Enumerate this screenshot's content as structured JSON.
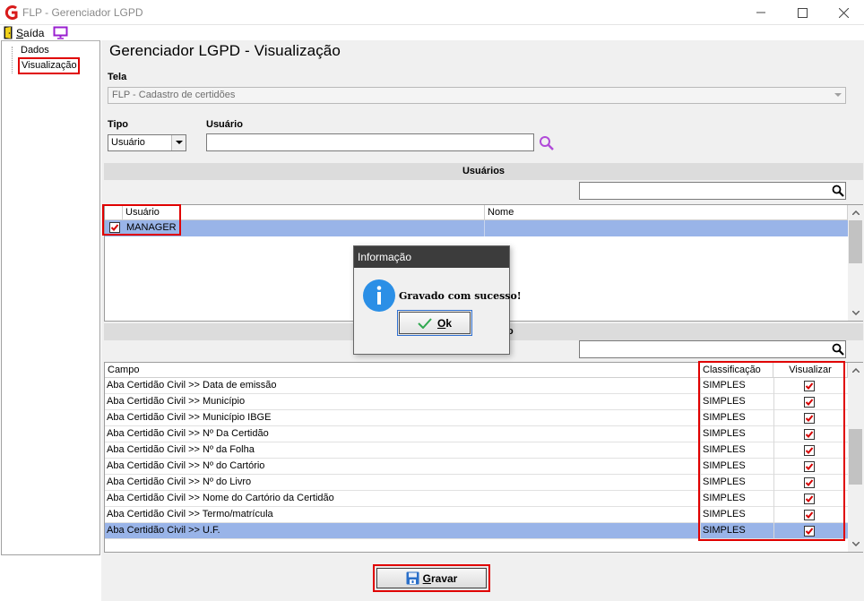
{
  "window": {
    "title": "FLP - Gerenciador LGPD",
    "controls": [
      "minimize-icon",
      "maximize-icon",
      "close-icon"
    ]
  },
  "menu": {
    "saida": "Saída",
    "icons": [
      "exit-door-icon",
      "monitor-icon"
    ]
  },
  "tree": {
    "items": [
      {
        "label": "Dados"
      },
      {
        "label": "Visualização"
      }
    ]
  },
  "main": {
    "title": "Gerenciador LGPD - Visualização",
    "tela": {
      "label": "Tela",
      "value": "FLP - Cadastro de certidões"
    },
    "tipo": {
      "label": "Tipo",
      "value": "Usuário"
    },
    "usuario": {
      "label": "Usuário",
      "value": ""
    }
  },
  "users_section": {
    "header": "Usuários",
    "filter": "",
    "columns": [
      "Usuário",
      "Nome"
    ],
    "rows": [
      {
        "checked": true,
        "usuario": "MANAGER",
        "nome": ""
      }
    ]
  },
  "fields_section": {
    "header_suffix": "o",
    "filter": "",
    "columns": [
      "Campo",
      "Classificação",
      "Visualizar"
    ],
    "rows": [
      {
        "campo": "Aba Certidão Civil >> Data de emissão",
        "classificacao": "SIMPLES",
        "visualizar": true
      },
      {
        "campo": "Aba Certidão Civil >> Município",
        "classificacao": "SIMPLES",
        "visualizar": true
      },
      {
        "campo": "Aba Certidão Civil >> Município IBGE",
        "classificacao": "SIMPLES",
        "visualizar": true
      },
      {
        "campo": "Aba Certidão Civil >> Nº Da Certidão",
        "classificacao": "SIMPLES",
        "visualizar": true
      },
      {
        "campo": "Aba Certidão Civil >> Nº da Folha",
        "classificacao": "SIMPLES",
        "visualizar": true
      },
      {
        "campo": "Aba Certidão Civil >> Nº do Cartório",
        "classificacao": "SIMPLES",
        "visualizar": true
      },
      {
        "campo": "Aba Certidão Civil >> Nº do Livro",
        "classificacao": "SIMPLES",
        "visualizar": true
      },
      {
        "campo": "Aba Certidão Civil >> Nome do Cartório da Certidão",
        "classificacao": "SIMPLES",
        "visualizar": true
      },
      {
        "campo": "Aba Certidão Civil >> Termo/matrícula",
        "classificacao": "SIMPLES",
        "visualizar": true
      },
      {
        "campo": "Aba Certidão Civil >> U.F.",
        "classificacao": "SIMPLES",
        "visualizar": true,
        "selected": true
      }
    ]
  },
  "footer": {
    "gravar_label": "Gravar",
    "gravar_underline": "G",
    "gravar_rest": "ravar"
  },
  "dialog": {
    "title": "Informação",
    "message": "Gravado com sucesso!",
    "ok_underline": "O",
    "ok_rest": "k"
  },
  "colors": {
    "highlight_red": "#e00000",
    "selection_blue": "#99b4e8",
    "dialog_title_bg": "#3c3c3c",
    "info_icon_blue": "#2b8fe6",
    "checkbox_red": "#d40000"
  }
}
